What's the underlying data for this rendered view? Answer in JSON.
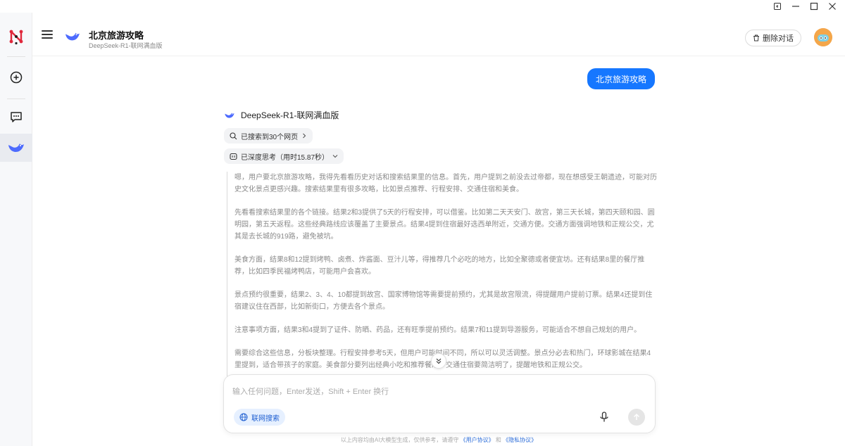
{
  "window": {
    "controls": [
      "restore-icon",
      "minimize-icon",
      "maximize-icon",
      "close-icon"
    ]
  },
  "header": {
    "title": "北京旅游攻略",
    "model": "DeepSeek-R1-联网满血版",
    "delete_label": "删除对话"
  },
  "chat": {
    "user_message": "北京旅游攻略",
    "assistant_name": "DeepSeek-R1-联网满血版",
    "search_pill": "已搜索到30个网页",
    "think_pill": "已深度思考（用时15.87秒）",
    "thinking": [
      "嗯，用户要北京旅游攻略，我得先看看历史对话和搜索结果里的信息。首先，用户提到之前没去过帝都，现在想感受王朝遗迹，可能对历史文化景点更感兴趣。搜索结果里有很多攻略，比如景点推荐、行程安排、交通住宿和美食。",
      "先看看搜索结果里的各个链接。结果2和3提供了5天的行程安排，可以借鉴。比如第二天天安门、故宫，第三天长城，第四天颐和园、圆明园，第五天返程。这些经典路线应该覆盖了主要景点。结果4提到住宿最好选西单附近，交通方便。交通方面强调地铁和正规公交，尤其是去长城的919路，避免被坑。",
      "美食方面，结果8和12提到烤鸭、卤煮、炸酱面、豆汁儿等，得推荐几个必吃的地方，比如全聚德或者便宜坊。还有结果8里的餐厅推荐，比如四季民福烤鸭店，可能用户会喜欢。",
      "景点预约很重要，结果2、3、4、10都提到故宫、国家博物馆等需要提前预约，尤其是故宫限流，得提醒用户提前订票。结果4还提到住宿建议住在西部，比如新街口，方便去各个景点。",
      "注意事项方面，结果3和4提到了证件、防晒、药品，还有旺季提前预约。结果7和11提到导游服务，可能适合不想自己规划的用户。",
      "需要综合这些信息，分板块整理。行程安排参考5天，但用户可能时间不同，所以可以灵活调整。景点分必去和热门，环球影城在结果4里提到，适合带孩子的家庭。美食部分要列出经典小吃和推荐餐厅。交通住宿要简洁明了，提醒地铁和正规公交。"
    ]
  },
  "composer": {
    "placeholder": "输入任何问题，Enter发送，Shift + Enter 换行",
    "web_search_label": "联网搜索"
  },
  "footer": {
    "text": "以上内容均由AI大模型生成，仅供参考，请遵守",
    "user_agreement": "《用户协议》",
    "and": "和",
    "privacy": "《隐私协议》"
  },
  "colors": {
    "accent": "#1677ff",
    "rail_bg": "#f7f8fa",
    "logo_red": "#e0283c"
  }
}
